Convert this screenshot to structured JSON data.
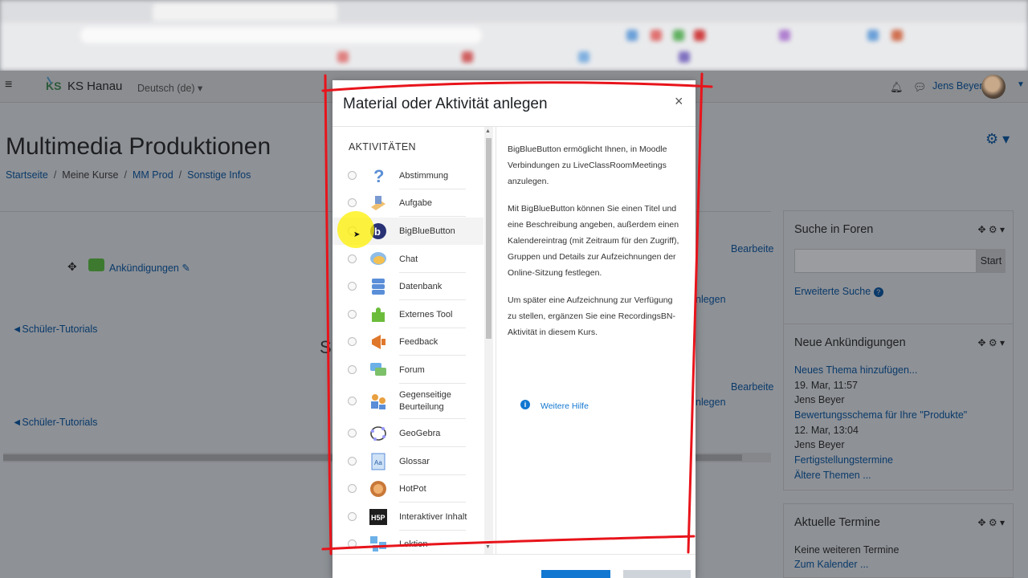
{
  "navbar": {
    "site_name": "KS Hanau",
    "language": "Deutsch (de)",
    "user_name": "Jens Beyer"
  },
  "page": {
    "title": "Multimedia Produktionen",
    "breadcrumb": [
      "Startseite",
      "Meine Kurse",
      "MM Prod",
      "Sonstige Infos"
    ]
  },
  "course": {
    "announcements_link": "Ankündigungen",
    "tutorials_1": "◄Schüler-Tutorials",
    "tutorials_2": "◄Schüler-Tutorials",
    "edit_1": "Bearbeite",
    "edit_2": "Bearbeite",
    "add_1": "nlegen",
    "add_2": "nlegen",
    "section_letter": "S"
  },
  "blocks": {
    "search_forums": {
      "title": "Suche in Foren",
      "button": "Start",
      "advanced_link": "Erweiterte Suche"
    },
    "news": {
      "title": "Neue Ankündigungen",
      "add_topic": "Neues Thema hinzufügen...",
      "post1_date": "19. Mar, 11:57",
      "post1_author": "Jens Beyer",
      "post1_title": "Bewertungsschema für Ihre \"Produkte\"",
      "post2_date": "12. Mar, 13:04",
      "post2_author": "Jens Beyer",
      "post2_title": "Fertigstellungstermine",
      "older": "Ältere Themen ..."
    },
    "events": {
      "title": "Aktuelle Termine",
      "none": "Keine weiteren Termine",
      "calendar": "Zum Kalender ..."
    }
  },
  "modal": {
    "title": "Material oder Aktivität anlegen",
    "close": "×",
    "section_heading": "AKTIVITÄTEN",
    "activities": [
      {
        "label": "Abstimmung",
        "icon": "question-icon"
      },
      {
        "label": "Aufgabe",
        "icon": "assignment-icon"
      },
      {
        "label": "BigBlueButton",
        "icon": "bigbluebutton-icon"
      },
      {
        "label": "Chat",
        "icon": "chat-icon"
      },
      {
        "label": "Datenbank",
        "icon": "database-icon"
      },
      {
        "label": "Externes Tool",
        "icon": "puzzle-icon"
      },
      {
        "label": "Feedback",
        "icon": "megaphone-icon"
      },
      {
        "label": "Forum",
        "icon": "forum-icon"
      },
      {
        "label": "Gegenseitige Beurteilung",
        "icon": "workshop-icon"
      },
      {
        "label": "GeoGebra",
        "icon": "geogebra-icon"
      },
      {
        "label": "Glossar",
        "icon": "glossary-icon"
      },
      {
        "label": "HotPot",
        "icon": "hotpot-icon"
      },
      {
        "label": "Interaktiver Inhalt",
        "icon": "h5p-icon"
      },
      {
        "label": "Lektion",
        "icon": "lesson-icon"
      }
    ],
    "help": {
      "p1": "BigBlueButton ermöglicht Ihnen, in Moodle Verbindungen zu LiveClassRoomMeetings anzulegen.",
      "p2": "Mit BigBlueButton können Sie einen Titel und eine Beschreibung angeben, außerdem einen Kalendereintrag (mit Zeitraum für den Zugriff), Gruppen und Details zur Aufzeichnungen der Online-Sitzung festlegen.",
      "p3": "Um später eine Aufzeichnung zur Verfügung zu stellen, ergänzen Sie eine RecordingsBN-Aktivität in diesem Kurs.",
      "more_help": "Weitere Hilfe"
    }
  },
  "colors": {
    "link": "#1177d1",
    "annotation": "#e8141b",
    "highlight": "#fff000"
  }
}
